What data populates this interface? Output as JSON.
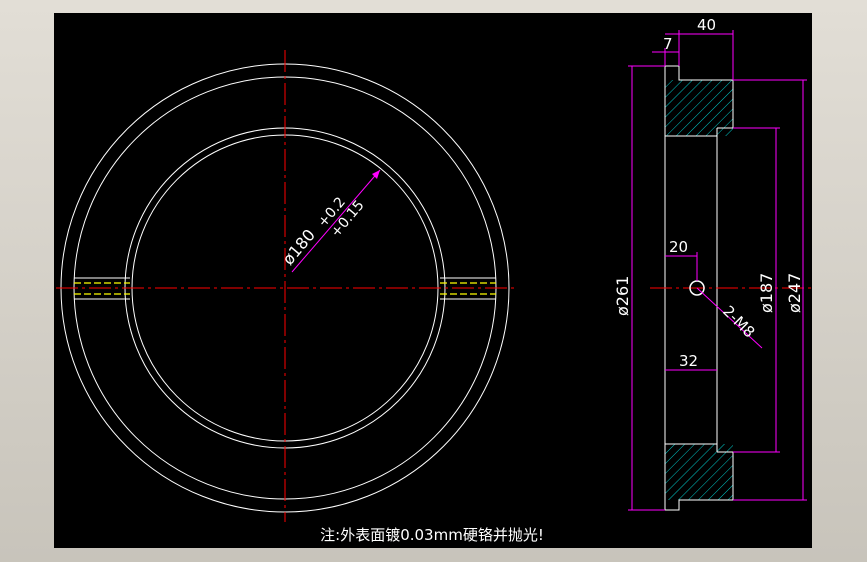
{
  "drawing": {
    "dimensions": {
      "dia_180": "ø180",
      "tol_upper": "+0.2",
      "tol_lower": "+0.15",
      "width_40": "40",
      "width_7": "7",
      "dia_261": "ø261",
      "dia_187": "ø187",
      "dia_247": "ø247",
      "len_20": "20",
      "len_32": "32",
      "thread": "2-M8"
    },
    "note": "注:外表面镀0.03mm硬铬并抛光!",
    "colors": {
      "background": "#000000",
      "outline": "#ffffff",
      "centerline": "#ff0000",
      "dimension": "#ff00ff",
      "hidden": "#ffff00",
      "hatch": "#00c8c8"
    }
  }
}
